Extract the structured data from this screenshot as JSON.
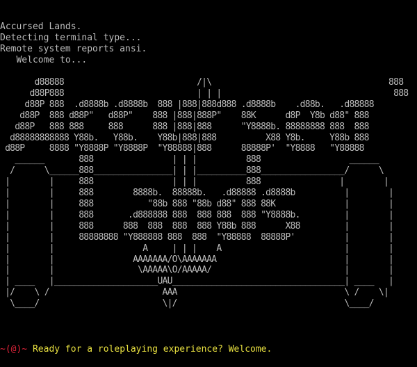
{
  "terminal": {
    "colors": {
      "background": "#000000",
      "text": "#bcbcbc",
      "prompt_symbol": "#e0243a",
      "prompt_text": "#e8e040"
    },
    "intro_lines": [
      "Accursed Lands.",
      "Detecting terminal type...",
      "Remote system reports ansi.",
      "   Welcome to..."
    ],
    "banner_art": "       d88888                           /|\\                                    888\n      d88P888                           | | |                                   888\n     d88P 888  .d8888b .d8888b  888 |888|888d888 .d8888b    .d88b.   .d88888\n    d88P  888 d88P\"   d88P\"    888 |888|888P\"    88K      d8P  Y8b d88\" 888\n   d88P   888 888     888      888 |888|888      \"Y8888b. 88888888 888  888\n  d88888888888 Y88b.   Y88b.    Y88b|888|888          X88 Y8b.     Y88b 888\n d88P     8888 \"Y8888P \"Y8888P  \"Y88888|888      88888P'  \"Y8888   \"Y88888\n   ______       888                | | |          888                  ______\n  /      \\______888________________| | |__________888_________________/      \\\n |        |     888                | | |          888                |        |\n |        |     888        8888b.  88888b.   .d88888 .d8888b          |        |\n |        |     888           \"88b 888 \"88b d88\" 888 88K              |        |\n |        |     888       .d888888 888  888 888  888 \"Y8888b.         |        |\n |        |     888      888  888  888  888 Y88b 888      X88         |        |\n |        |     88888888 \"Y888888 888  888  \"Y88888  88888P'          |        |\n |        |                  A     | | |    A                         |        |\n |        |                AAAAAAA/O\\AAAAAAA                          |        |\n |        |                 \\AAAAA\\O/AAAAA/                           |        |\n | ____   |_____________________UAU___________________________________| ____   |\n |/    \\ /                       AAA                                  \\ /    \\|\n  \\____/                         \\|/                                  \\____/",
    "prompt": {
      "symbol": "~(@)~",
      "message": " Ready for a roleplaying experience? Welcome."
    }
  }
}
